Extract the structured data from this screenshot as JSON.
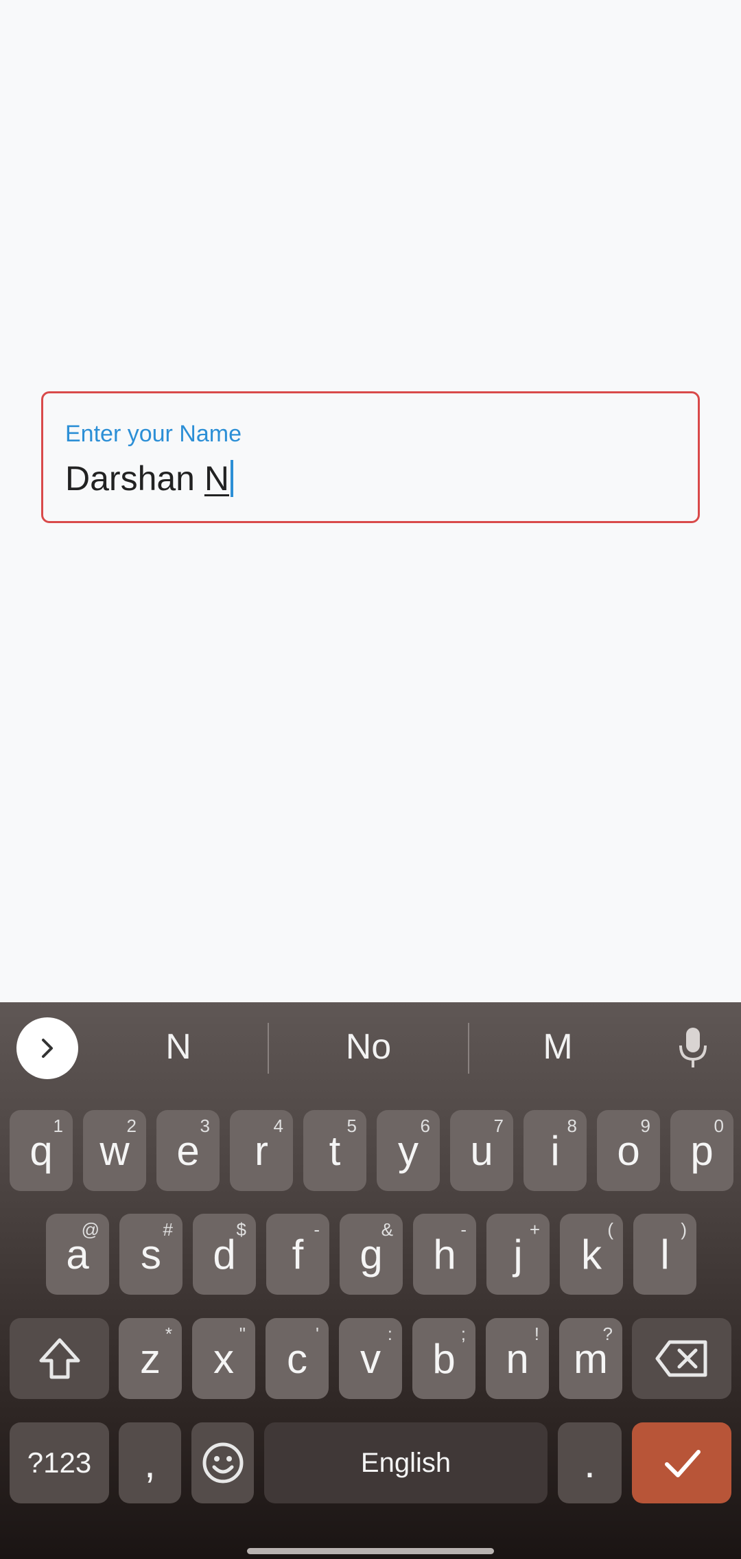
{
  "form": {
    "label": "Enter your Name",
    "value_prefix": "Darshan ",
    "value_composing": "N",
    "colors": {
      "label": "#2c8fd6",
      "border_error": "#d94a4a"
    }
  },
  "keyboard": {
    "suggestions": [
      "N",
      "No",
      "M"
    ],
    "row1": [
      {
        "k": "q",
        "h": "1"
      },
      {
        "k": "w",
        "h": "2"
      },
      {
        "k": "e",
        "h": "3"
      },
      {
        "k": "r",
        "h": "4"
      },
      {
        "k": "t",
        "h": "5"
      },
      {
        "k": "y",
        "h": "6"
      },
      {
        "k": "u",
        "h": "7"
      },
      {
        "k": "i",
        "h": "8"
      },
      {
        "k": "o",
        "h": "9"
      },
      {
        "k": "p",
        "h": "0"
      }
    ],
    "row2": [
      {
        "k": "a",
        "h": "@"
      },
      {
        "k": "s",
        "h": "#"
      },
      {
        "k": "d",
        "h": "$"
      },
      {
        "k": "f",
        "h": "-"
      },
      {
        "k": "g",
        "h": "&"
      },
      {
        "k": "h",
        "h": "-"
      },
      {
        "k": "j",
        "h": "+"
      },
      {
        "k": "k",
        "h": "("
      },
      {
        "k": "l",
        "h": ")"
      }
    ],
    "row3": [
      {
        "k": "z",
        "h": "*"
      },
      {
        "k": "x",
        "h": "\""
      },
      {
        "k": "c",
        "h": "'"
      },
      {
        "k": "v",
        "h": ":"
      },
      {
        "k": "b",
        "h": ";"
      },
      {
        "k": "n",
        "h": "!"
      },
      {
        "k": "m",
        "h": "?"
      }
    ],
    "symbols_label": "?123",
    "comma": ",",
    "space_label": "English",
    "period": ".",
    "icons": [
      "chevron-right-icon",
      "mic-icon",
      "shift-icon",
      "backspace-icon",
      "emoji-icon",
      "check-icon"
    ],
    "enter_color": "#b85538"
  }
}
